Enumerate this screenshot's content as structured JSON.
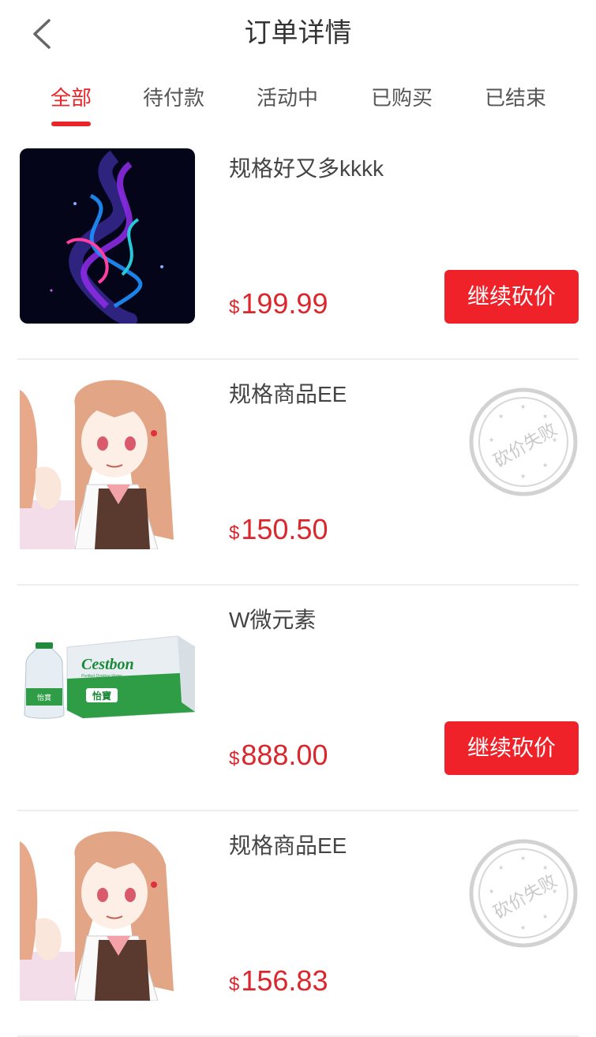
{
  "header": {
    "title": "订单详情",
    "back_icon": "chevron-left-icon"
  },
  "tabs": [
    {
      "label": "全部",
      "active": true
    },
    {
      "label": "待付款",
      "active": false
    },
    {
      "label": "活动中",
      "active": false
    },
    {
      "label": "已购买",
      "active": false
    },
    {
      "label": "已结束",
      "active": false
    }
  ],
  "orders": [
    {
      "name": "规格好又多kkkk",
      "currency": "$",
      "price": "199.99",
      "action": "继续砍价",
      "image": "abstract-art"
    },
    {
      "name": "规格商品EE",
      "currency": "$",
      "price": "150.50",
      "stamp": "砍价失败",
      "image": "anime-girl"
    },
    {
      "name": "W微元素",
      "currency": "$",
      "price": "888.00",
      "action": "继续砍价",
      "image": "water-bottle-box",
      "brand": "Cestbon",
      "brand_sub": "Purified Drinking Water",
      "brand_cn": "怡寶"
    },
    {
      "name": "规格商品EE",
      "currency": "$",
      "price": "156.83",
      "stamp": "砍价失败",
      "image": "anime-girl"
    }
  ],
  "colors": {
    "accent": "#e8262a",
    "button": "#ee2228",
    "price": "#d9272d",
    "stamp": "#cfcfcf"
  }
}
